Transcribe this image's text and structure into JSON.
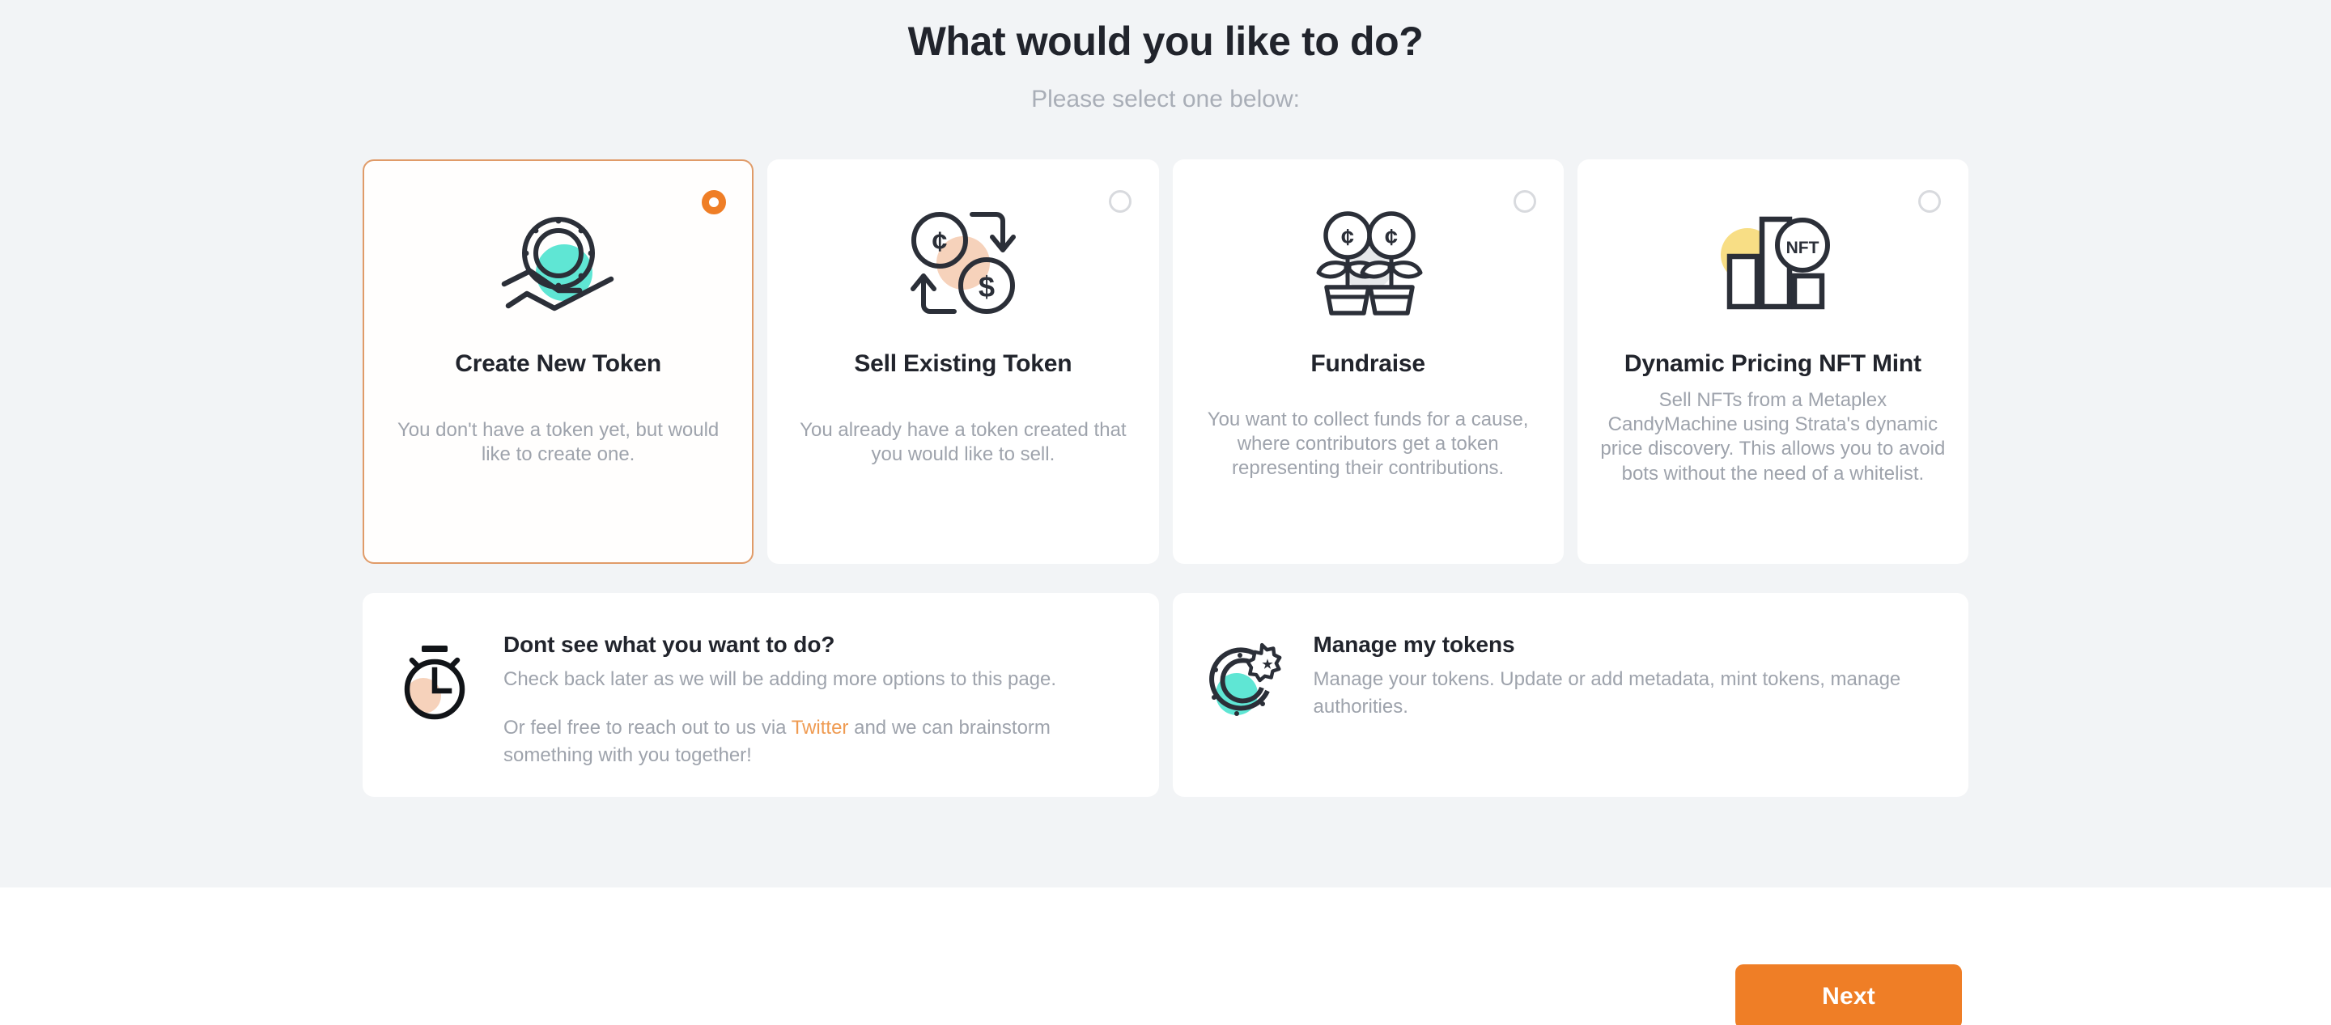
{
  "header": {
    "title": "What would you like to do?",
    "subtitle": "Please select one below:"
  },
  "colors": {
    "page_background": "#f2f4f6",
    "card_background": "#ffffff",
    "accent_orange": "#ef7e26",
    "selected_border": "#e09b68",
    "link_orange": "#ef9b52",
    "title_text": "#21242c",
    "muted_text": "#9ea3ac",
    "icon_dark": "#2b2f38",
    "icon_teal": "#5fe6d4",
    "icon_peach": "#f6d2bb",
    "icon_yellow": "#f8de85",
    "icon_gray": "#e6e8ea"
  },
  "options": [
    {
      "id": "create-new-token",
      "title": "Create New Token",
      "description": "You don't have a token yet, but would like to create one.",
      "icon": "hand-holding-coin-icon",
      "selected": true
    },
    {
      "id": "sell-existing-token",
      "title": "Sell Existing Token",
      "description": "You already have a token created that you would like to sell.",
      "icon": "currency-exchange-icon",
      "selected": false
    },
    {
      "id": "fundraise",
      "title": "Fundraise",
      "description": "You want to collect funds for a cause, where contributors get a token representing their contributions.",
      "icon": "money-plants-icon",
      "selected": false
    },
    {
      "id": "dynamic-pricing-nft-mint",
      "title": "Dynamic Pricing NFT Mint",
      "description": "Sell NFTs from a Metaplex CandyMachine using Strata's dynamic price discovery. This allows you to avoid bots without the need of a whitelist.",
      "icon": "nft-bar-chart-icon",
      "selected": false
    }
  ],
  "info_panels": [
    {
      "id": "dont-see-what-you-want",
      "icon": "stopwatch-icon",
      "title": "Dont see what you want to do?",
      "text_1": "Check back later as we will be adding more options to this page.",
      "text_2_before": "Or feel free to reach out to us via ",
      "link_label": "Twitter",
      "text_2_after": " and we can brainstorm something with you together!"
    },
    {
      "id": "manage-my-tokens",
      "icon": "token-settings-icon",
      "title": "Manage my tokens",
      "text_1": "Manage your tokens. Update or add metadata, mint tokens, manage authorities.",
      "text_2_before": "",
      "link_label": "",
      "text_2_after": ""
    }
  ],
  "footer": {
    "next_label": "Next"
  }
}
